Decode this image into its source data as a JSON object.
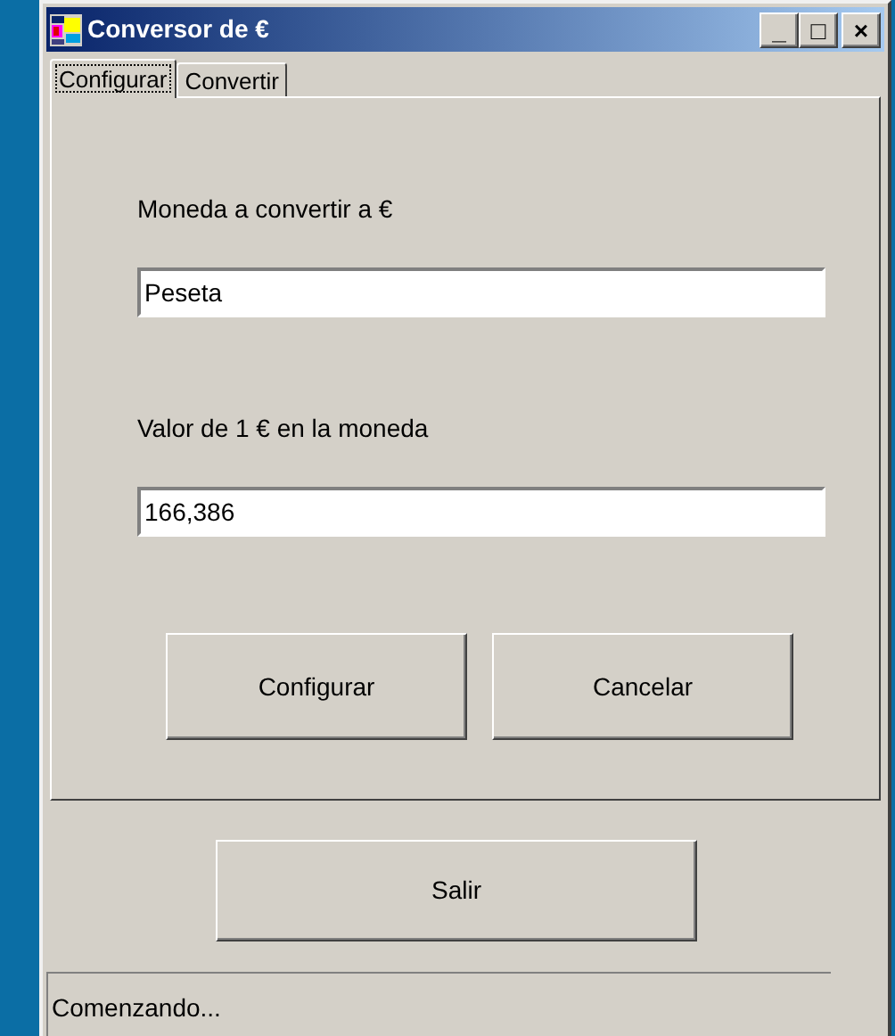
{
  "window": {
    "title": "Conversor de €",
    "controls": [
      "_",
      "□",
      "×"
    ]
  },
  "tabs": [
    {
      "label": "Configurar",
      "selected": true
    },
    {
      "label": "Convertir",
      "selected": false
    }
  ],
  "form": {
    "fields": [
      {
        "label": "Moneda a convertir a €",
        "value": "Peseta"
      },
      {
        "label": "Valor de 1 € en la moneda",
        "value": "166,386"
      }
    ],
    "buttons": [
      "Configurar",
      "Cancelar"
    ]
  },
  "exit_button": "Salir",
  "status_bar": "Comenzando..."
}
